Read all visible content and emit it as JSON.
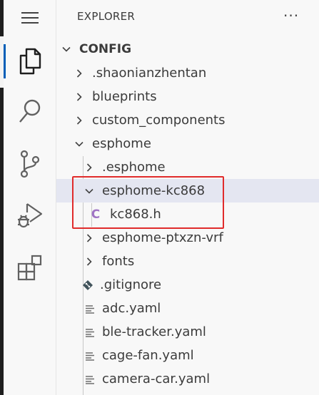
{
  "explorer": {
    "title": "EXPLORER",
    "more_actions": "···",
    "root": {
      "label": "CONFIG",
      "expanded": true
    },
    "items": [
      {
        "label": ".shaonianzhentan",
        "kind": "folder",
        "expanded": false,
        "depth": 1
      },
      {
        "label": "blueprints",
        "kind": "folder",
        "expanded": false,
        "depth": 1
      },
      {
        "label": "custom_components",
        "kind": "folder",
        "expanded": false,
        "depth": 1
      },
      {
        "label": "esphome",
        "kind": "folder",
        "expanded": true,
        "depth": 1
      },
      {
        "label": ".esphome",
        "kind": "folder",
        "expanded": false,
        "depth": 2
      },
      {
        "label": "esphome-kc868",
        "kind": "folder",
        "expanded": true,
        "depth": 2,
        "selected": true
      },
      {
        "label": "kc868.h",
        "kind": "c-header",
        "icon_text": "C",
        "depth": 3
      },
      {
        "label": "esphome-ptxzn-vrf",
        "kind": "folder",
        "expanded": false,
        "depth": 2
      },
      {
        "label": "fonts",
        "kind": "folder",
        "expanded": false,
        "depth": 2
      },
      {
        "label": ".gitignore",
        "kind": "git",
        "depth": 2
      },
      {
        "label": "adc.yaml",
        "kind": "yaml",
        "depth": 2
      },
      {
        "label": "ble-tracker.yaml",
        "kind": "yaml",
        "depth": 2
      },
      {
        "label": "cage-fan.yaml",
        "kind": "yaml",
        "depth": 2
      },
      {
        "label": "camera-car.yaml",
        "kind": "yaml",
        "depth": 2
      }
    ]
  },
  "activity_bar": {
    "items": [
      "menu-icon",
      "explorer-icon",
      "search-icon",
      "source-control-icon",
      "run-debug-icon",
      "extensions-icon"
    ],
    "active": "explorer-icon"
  },
  "colors": {
    "accent": "#005fb8",
    "selection": "#e4e6f1",
    "highlight_box": "#e02b2b",
    "c_icon": "#a074c4"
  }
}
